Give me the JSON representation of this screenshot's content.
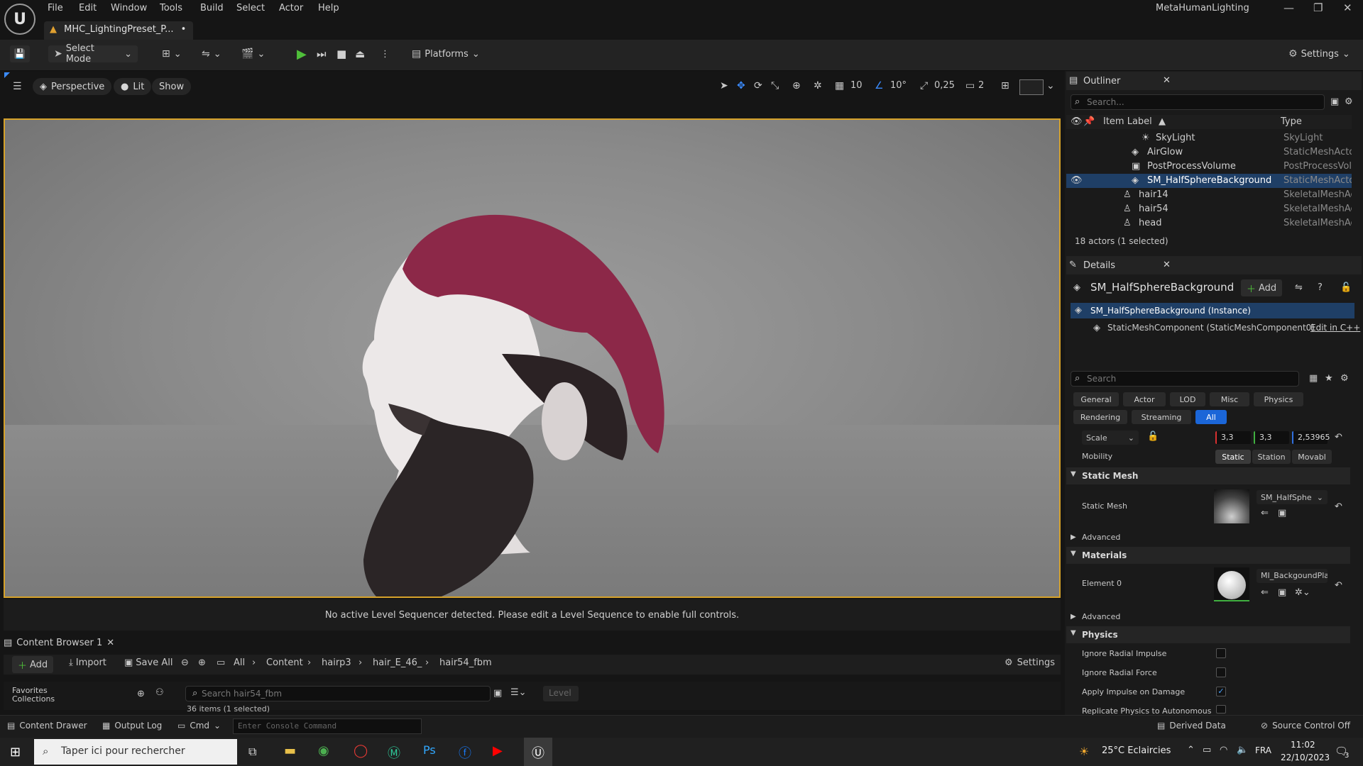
{
  "app": {
    "window_title": "MetaHumanLighting",
    "logo": "U"
  },
  "menu": [
    "File",
    "Edit",
    "Window",
    "Tools",
    "Build",
    "Select",
    "Actor",
    "Help"
  ],
  "doc_tab": {
    "label": "MHC_LightingPreset_P...",
    "modified": "•"
  },
  "toolbar": {
    "select_mode": "Select Mode",
    "platforms": "Platforms",
    "settings": "Settings"
  },
  "viewport_toolbar": {
    "perspective": "Perspective",
    "lit": "Lit",
    "show": "Show",
    "grid_size": "10",
    "angle_snap": "10°",
    "scale_snap": "0,25",
    "camera_speed": "2"
  },
  "sequencer_msg": "No active Level Sequencer detected. Please edit a Level Sequence to enable full controls.",
  "outliner": {
    "title": "Outliner",
    "search_placeholder": "Search...",
    "col_label": "Item Label",
    "col_type": "Type",
    "rows": [
      {
        "name": "SkyLight",
        "type": "SkyLight"
      },
      {
        "name": "AirGlow",
        "type": "StaticMeshActo"
      },
      {
        "name": "PostProcessVolume",
        "type": "PostProcessVol"
      },
      {
        "name": "SM_HalfSphereBackground",
        "type": "StaticMeshActo"
      },
      {
        "name": "hair14",
        "type": "SkeletalMeshAc"
      },
      {
        "name": "hair54",
        "type": "SkeletalMeshAc"
      },
      {
        "name": "head",
        "type": "SkeletalMeshAc"
      }
    ],
    "footer": "18 actors (1 selected)"
  },
  "details": {
    "title": "Details",
    "actor_name": "SM_HalfSphereBackground",
    "add": "Add",
    "instance": "SM_HalfSphereBackground (Instance)",
    "component": "StaticMeshComponent (StaticMeshComponent0)",
    "edit_cpp": "Edit in C++",
    "search_placeholder": "Search",
    "tabs_row1": [
      "General",
      "Actor",
      "LOD",
      "Misc",
      "Physics"
    ],
    "tabs_row2": [
      "Rendering",
      "Streaming",
      "All"
    ],
    "scale_label": "Scale",
    "scale": [
      "3,3",
      "3,3",
      "2,53965"
    ],
    "mobility_label": "Mobility",
    "mobility": [
      "Static",
      "Station",
      "Movabl"
    ],
    "sec_static_mesh": "Static Mesh",
    "static_mesh_label": "Static Mesh",
    "static_mesh_value": "SM_HalfSphe",
    "advanced": "Advanced",
    "sec_materials": "Materials",
    "element0_label": "Element 0",
    "element0_value": "MI_BackgoundPlane",
    "sec_physics": "Physics",
    "physics_props": [
      {
        "label": "Ignore Radial Impulse",
        "checked": false
      },
      {
        "label": "Ignore Radial Force",
        "checked": false
      },
      {
        "label": "Apply Impulse on Damage",
        "checked": true
      },
      {
        "label": "Replicate Physics to Autonomous",
        "checked": false
      }
    ]
  },
  "content_browser": {
    "tab": "Content Browser 1",
    "add": "Add",
    "import": "Import",
    "save_all": "Save All",
    "path": [
      "All",
      "Content",
      "hairp3",
      "hair_E_46_",
      "hair54_fbm"
    ],
    "settings": "Settings",
    "favorites": "Favorites",
    "collections": "Collections",
    "search_placeholder": "Search hair54_fbm",
    "level": "Level",
    "count": "36 items (1 selected)"
  },
  "bottom": {
    "content_drawer": "Content Drawer",
    "output_log": "Output Log",
    "cmd": "Cmd",
    "console_placeholder": "Enter Console Command",
    "derived_data": "Derived Data",
    "source_control": "Source Control Off"
  },
  "taskbar": {
    "search": "Taper ici pour rechercher",
    "weather": "25°C  Eclaircies",
    "lang": "FRA",
    "time": "11:02",
    "date": "22/10/2023",
    "notif": "3"
  }
}
